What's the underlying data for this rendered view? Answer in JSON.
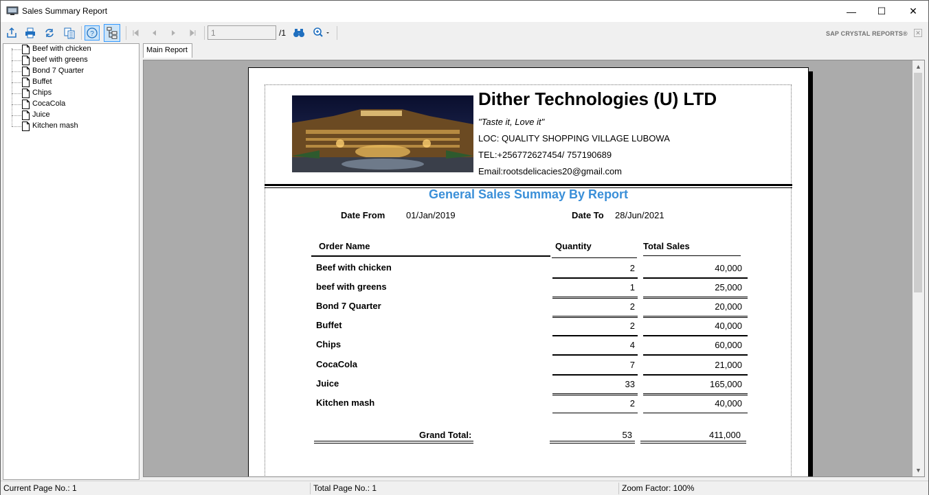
{
  "window": {
    "title": "Sales Summary Report",
    "minimize": "—",
    "maximize": "☐",
    "close": "✕"
  },
  "toolbar": {
    "page_input_value": "1",
    "page_total": "/1",
    "brand": "SAP CRYSTAL REPORTS®",
    "brand_close": "✕"
  },
  "group_tree": {
    "items": [
      {
        "label": "Beef with chicken"
      },
      {
        "label": "beef with greens"
      },
      {
        "label": "Bond 7 Quarter"
      },
      {
        "label": "Buffet"
      },
      {
        "label": "Chips"
      },
      {
        "label": "CocaCola"
      },
      {
        "label": "Juice"
      },
      {
        "label": "Kitchen mash"
      }
    ]
  },
  "tabs": {
    "main": "Main Report"
  },
  "report": {
    "company": "Dither Technologies (U) LTD",
    "slogan": "\"Taste it, Love it\"",
    "location": "LOC:  QUALITY SHOPPING VILLAGE LUBOWA",
    "tel": "TEL:+256772627454/ 757190689",
    "email": "Email:rootsdelicacies20@gmail.com",
    "title": "General Sales Summay By Report",
    "date_from_label": "Date From",
    "date_from": "01/Jan/2019",
    "date_to_label": "Date To",
    "date_to": "28/Jun/2021",
    "columns": {
      "order_name": "Order Name",
      "quantity": "Quantity",
      "total_sales": "Total Sales"
    },
    "rows": [
      {
        "name": "Beef with chicken",
        "qty": "2",
        "sales": "40,000"
      },
      {
        "name": "beef with greens",
        "qty": "1",
        "sales": "25,000"
      },
      {
        "name": "Bond 7 Quarter",
        "qty": "2",
        "sales": "20,000"
      },
      {
        "name": "Buffet",
        "qty": "2",
        "sales": "40,000"
      },
      {
        "name": "Chips",
        "qty": "4",
        "sales": "60,000"
      },
      {
        "name": "CocaCola",
        "qty": "7",
        "sales": "21,000"
      },
      {
        "name": "Juice",
        "qty": "33",
        "sales": "165,000"
      },
      {
        "name": "Kitchen mash",
        "qty": "2",
        "sales": "40,000"
      }
    ],
    "grand_total_label": "Grand Total:",
    "grand_total_qty": "53",
    "grand_total_sales": "411,000"
  },
  "status": {
    "current_page": "Current Page No.: 1",
    "total_page": "Total Page No.: 1",
    "zoom": "Zoom Factor: 100%"
  },
  "colors": {
    "title_blue": "#3a8fd8",
    "toolbar_icon_blue": "#1f6fbf",
    "active_button": "#cce4f7"
  }
}
